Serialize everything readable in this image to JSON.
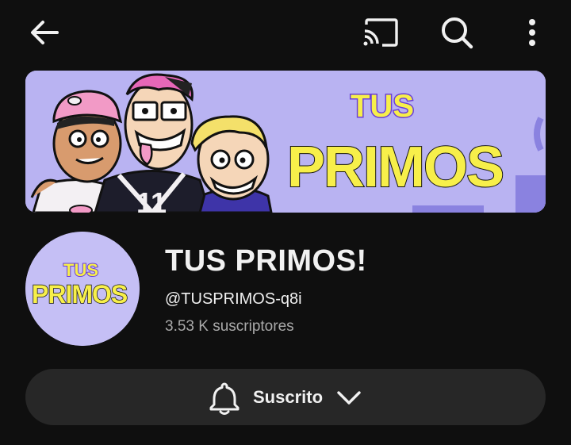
{
  "topbar": {
    "icons": [
      "back-arrow-icon",
      "cast-icon",
      "search-icon",
      "more-vert-icon"
    ]
  },
  "banner": {
    "logo_line1": "TUS",
    "logo_line2": "PRIMOS",
    "jersey_number": "11",
    "background_color": "#b9b3f2"
  },
  "avatar": {
    "logo_line1": "TUS",
    "logo_line2": "PRIMOS"
  },
  "channel": {
    "title": "TUS PRIMOS!",
    "handle": "@TUSPRIMOS-q8i",
    "subscribers": "3.53 K suscriptores"
  },
  "subscribe_button": {
    "label": "Suscrito",
    "icon": "bell-icon",
    "dropdown_icon": "chevron-down-icon"
  },
  "colors": {
    "background": "#0f0f0f",
    "button_bg": "#272727",
    "text_primary": "#f1f1f1",
    "text_secondary": "#aaaaaa",
    "logo_yellow": "#f7ef4a",
    "logo_purple": "#6a3fd9",
    "logo_pink": "#f29ac6",
    "logo_green": "#8fe39a"
  }
}
